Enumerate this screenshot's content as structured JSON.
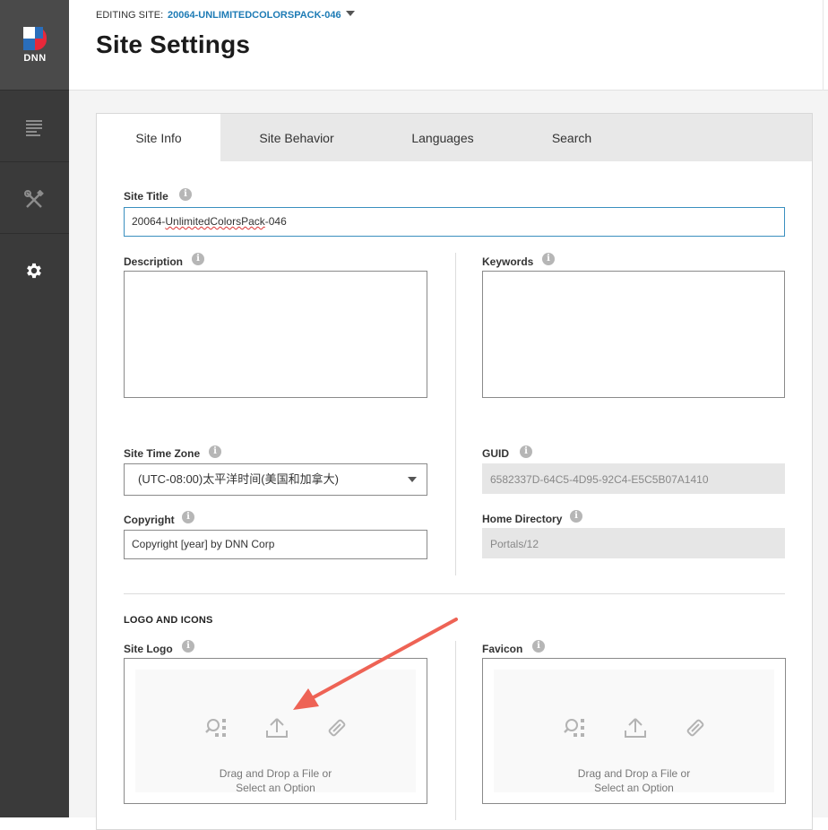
{
  "brand": {
    "logo_text": "DNN"
  },
  "header": {
    "editing_label": "EDITING SITE:",
    "editing_site": "20064-UNLIMITEDCOLORSPACK-046",
    "title": "Site Settings"
  },
  "tabs": [
    {
      "label": "Site Info",
      "active": true
    },
    {
      "label": "Site Behavior"
    },
    {
      "label": "Languages"
    },
    {
      "label": "Search"
    }
  ],
  "form": {
    "site_title": {
      "label": "Site Title",
      "value_prefix": "20064-",
      "value_misspelled": "UnlimitedColorsPack",
      "value_suffix": "-046"
    },
    "description": {
      "label": "Description",
      "value": ""
    },
    "keywords": {
      "label": "Keywords",
      "value": ""
    },
    "time_zone": {
      "label": "Site Time Zone",
      "value": "(UTC-08:00)太平洋时间(美国和加拿大)"
    },
    "guid": {
      "label": "GUID",
      "value": "6582337D-64C5-4D95-92C4-E5C5B07A1410"
    },
    "copyright": {
      "label": "Copyright",
      "value": "Copyright [year] by DNN Corp"
    },
    "home_directory": {
      "label": "Home Directory",
      "value": "Portals/12"
    }
  },
  "logo_section": {
    "title": "LOGO AND ICONS",
    "site_logo": {
      "label": "Site Logo",
      "line1": "Drag and Drop a File or",
      "line2": "Select an Option"
    },
    "favicon": {
      "label": "Favicon",
      "line1": "Drag and Drop a File or",
      "line2": "Select an Option"
    }
  },
  "info_glyph": "i",
  "colors": {
    "accent": "#1d7bb5",
    "sidebar": "#3a3a3a",
    "annotation_arrow": "#ee6355"
  }
}
